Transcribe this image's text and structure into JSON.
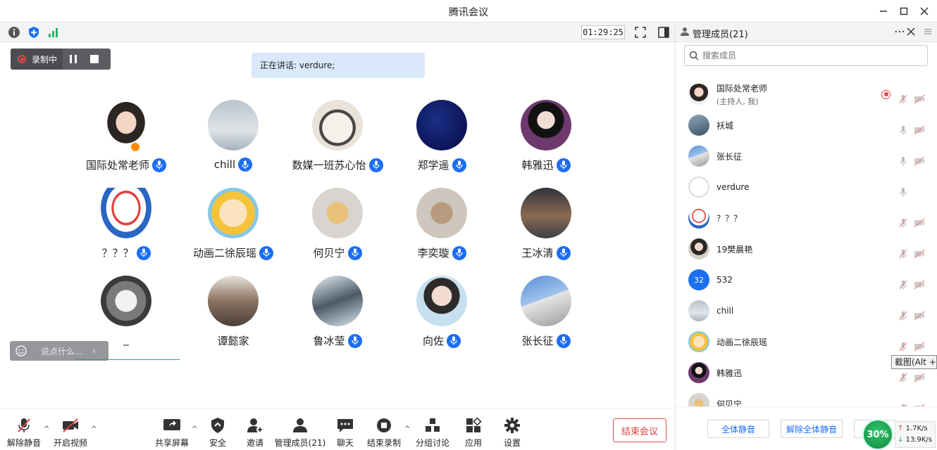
{
  "window": {
    "title": "腾讯会议"
  },
  "statusbar": {
    "timer": "01:29:25"
  },
  "recording": {
    "label": "录制中"
  },
  "speaking": {
    "text": "正在讲话: verdure;"
  },
  "tiles": [
    {
      "name": "国际处常老师",
      "mic": true
    },
    {
      "name": "chill",
      "mic": true
    },
    {
      "name": "数媒一班苏心怡",
      "mic": true
    },
    {
      "name": "郑学遥",
      "mic": true
    },
    {
      "name": "韩雅迅",
      "mic": true
    },
    {
      "name": "？？？",
      "mic": true
    },
    {
      "name": "动画二徐辰瑶",
      "mic": true
    },
    {
      "name": "何贝宁",
      "mic": true
    },
    {
      "name": "李奕璇",
      "mic": true
    },
    {
      "name": "王冰清",
      "mic": true
    },
    {
      "name": "_",
      "mic": false
    },
    {
      "name": "谭懿家",
      "mic": false
    },
    {
      "name": "鲁冰莹",
      "mic": true
    },
    {
      "name": "向佐",
      "mic": true
    },
    {
      "name": "张长征",
      "mic": true
    }
  ],
  "chat": {
    "placeholder": "说点什么..."
  },
  "toolbar": {
    "unmute": "解除静音",
    "start_video": "开启视频",
    "share_screen": "共享屏幕",
    "security": "安全",
    "invite": "邀请",
    "manage_members": "管理成员(21)",
    "chat": "聊天",
    "end_recording": "结束录制",
    "breakout": "分组讨论",
    "apps": "应用",
    "settings": "设置",
    "end_meeting": "结束会议"
  },
  "panel": {
    "title": "管理成员(21)",
    "search_placeholder": "搜索成员",
    "members": [
      {
        "name": "国际处常老师",
        "sub": "(主持人, 我)"
      },
      {
        "name": "袄城",
        "sub": ""
      },
      {
        "name": "张长征",
        "sub": ""
      },
      {
        "name": "verdure",
        "sub": ""
      },
      {
        "name": "？？？",
        "sub": ""
      },
      {
        "name": "19樊晨艳",
        "sub": ""
      },
      {
        "name": "532",
        "sub": "",
        "avatar_text": "32"
      },
      {
        "name": "chill",
        "sub": ""
      },
      {
        "name": "动画二徐辰瑶",
        "sub": ""
      },
      {
        "name": "韩雅迅",
        "sub": ""
      },
      {
        "name": "何贝宁",
        "sub": ""
      }
    ],
    "mute_all": "全体静音",
    "unmute_all": "解除全体静音"
  },
  "tooltip": {
    "text": "截图(Alt +"
  },
  "network": {
    "load": "30%",
    "upload": "1.7K/s",
    "download": "13.9K/s"
  },
  "colors": {
    "accent": "#1c6ef2",
    "danger": "#e03c3c",
    "recording": "#e04848"
  }
}
